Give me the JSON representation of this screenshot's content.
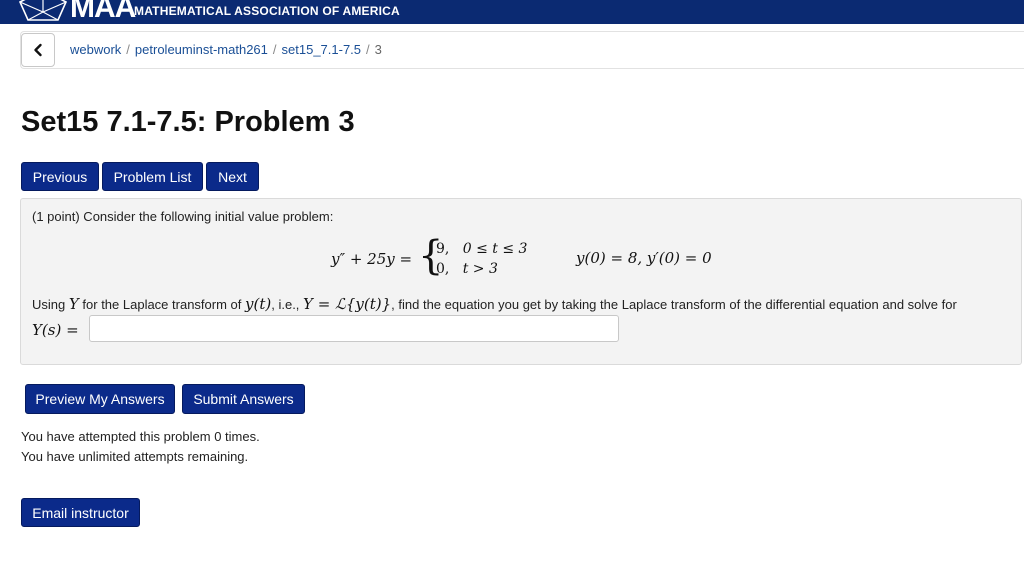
{
  "banner": {
    "logo_text": "MAA",
    "org_name": "MATHEMATICAL ASSOCIATION OF AMERICA",
    "color": "#0b2a72"
  },
  "breadcrumb": {
    "back_icon": "chevron-left-icon",
    "items": [
      "webwork",
      "petroleuminst-math261",
      "set15_7.1-7.5"
    ],
    "separator": "/",
    "current": "3"
  },
  "page": {
    "title": "Set15 7.1-7.5: Problem 3"
  },
  "nav": {
    "previous": "Previous",
    "problem_list": "Problem List",
    "next": "Next"
  },
  "problem": {
    "intro": "(1 point) Consider the following initial value problem:",
    "equation_lhs": "y″ + 25y =",
    "case1_value": "9,",
    "case1_cond": "0 ≤ t ≤ 3",
    "case2_value": "0,",
    "case2_cond": "t > 3",
    "initial_conditions": "y(0) = 8,  y′(0) = 0",
    "using_prefix": "Using",
    "using_var": "Y",
    "using_mid1": "for the Laplace transform of",
    "using_func": "y(t)",
    "using_mid2": ", i.e.,",
    "using_def": "Y = ℒ{y(t)}",
    "using_suffix": ", find the equation you get by taking the Laplace transform of the differential equation and solve for",
    "answer_label": "Y(s) =",
    "answer_value": ""
  },
  "actions": {
    "preview": "Preview My Answers",
    "submit": "Submit Answers",
    "email": "Email instructor"
  },
  "status": {
    "attempts": "You have attempted this problem 0 times.",
    "remaining": "You have unlimited attempts remaining."
  },
  "colors": {
    "button": "#0b2a8a",
    "link": "#1a4f96",
    "problem_bg": "#f3f3f3"
  }
}
